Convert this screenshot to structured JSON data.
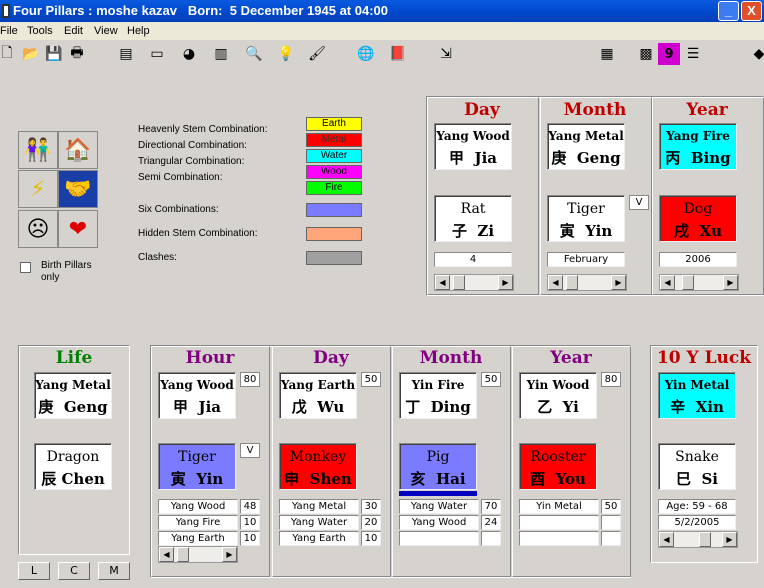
{
  "window": {
    "title": "Four Pillars : moshe kazav   Born:  5 December 1945 at 04:00",
    "min": "_",
    "close": "X"
  },
  "menu": [
    "File",
    "Tools",
    "Edit",
    "View",
    "Help"
  ],
  "colors": {
    "earth": "#ffff00",
    "metal": "#ff0000",
    "water": "#00ffff",
    "wood": "#ff00ff",
    "fire": "#00ff00",
    "six": "#7b7bff",
    "hidden": "#ffa67b",
    "clash": "#a0a0a0"
  },
  "legend": {
    "heavenly": "Heavenly Stem Combination:",
    "directional": "Directional Combination:",
    "triangular": "Triangular Combination:",
    "semi": "Semi Combination:",
    "six": "Six Combinations:",
    "hidden": "Hidden Stem Combination:",
    "clashes": "Clashes:",
    "swatches": [
      "Earth",
      "Metal",
      "Water",
      "Wood",
      "Fire"
    ]
  },
  "birth_pillars": "Birth Pillars only",
  "top": {
    "day": {
      "header": "Day",
      "stem_en": "Yang Wood",
      "stem_cn": "甲",
      "stem_py": "Jia",
      "branch_en": "Rat",
      "branch_cn": "子",
      "branch_py": "Zi",
      "value": "4"
    },
    "month": {
      "header": "Month",
      "stem_en": "Yang Metal",
      "stem_cn": "庚",
      "stem_py": "Geng",
      "branch_en": "Tiger",
      "branch_cn": "寅",
      "branch_py": "Yin",
      "value": "February",
      "tag": "V"
    },
    "year": {
      "header": "Year",
      "stem_en": "Yang Fire",
      "stem_cn": "丙",
      "stem_py": "Bing",
      "branch_en": "Dog",
      "branch_cn": "戌",
      "branch_py": "Xu",
      "value": "2006"
    }
  },
  "life": {
    "header": "Life",
    "stem_en": "Yang Metal",
    "stem_cn": "庚",
    "stem_py": "Geng",
    "branch_en": "Dragon",
    "branch_cn": "辰",
    "branch_py": "Chen"
  },
  "buttons": [
    "L",
    "C",
    "M"
  ],
  "pillars": [
    {
      "header": "Hour",
      "stem_en": "Yang Wood",
      "stem_cn": "甲",
      "stem_py": "Jia",
      "stem_num": "80",
      "branch_en": "Tiger",
      "branch_cn": "寅",
      "branch_py": "Yin",
      "branch_tag": "V",
      "hidden": [
        [
          "Yang Wood",
          "48"
        ],
        [
          "Yang Fire",
          "10"
        ],
        [
          "Yang Earth",
          "10"
        ]
      ]
    },
    {
      "header": "Day",
      "stem_en": "Yang Earth",
      "stem_cn": "戊",
      "stem_py": "Wu",
      "stem_num": "50",
      "branch_en": "Monkey",
      "branch_cn": "申",
      "branch_py": "Shen",
      "branch_tag": "",
      "hidden": [
        [
          "Yang Metal",
          "30"
        ],
        [
          "Yang Water",
          "20"
        ],
        [
          "Yang Earth",
          "10"
        ]
      ]
    },
    {
      "header": "Month",
      "stem_en": "Yin Fire",
      "stem_cn": "丁",
      "stem_py": "Ding",
      "stem_num": "50",
      "branch_en": "Pig",
      "branch_cn": "亥",
      "branch_py": "Hai",
      "branch_tag": "",
      "hidden": [
        [
          "Yang Water",
          "70"
        ],
        [
          "Yang Wood",
          "24"
        ],
        [
          "",
          ""
        ]
      ]
    },
    {
      "header": "Year",
      "stem_en": "Yin Wood",
      "stem_cn": "乙",
      "stem_py": "Yi",
      "stem_num": "80",
      "branch_en": "Rooster",
      "branch_cn": "酉",
      "branch_py": "You",
      "branch_tag": "",
      "hidden": [
        [
          "Yin Metal",
          "50"
        ],
        [
          "",
          ""
        ],
        [
          "",
          ""
        ]
      ]
    }
  ],
  "luck": {
    "header": "10 Y Luck",
    "stem_en": "Yin Metal",
    "stem_cn": "辛",
    "stem_py": "Xin",
    "branch_en": "Snake",
    "branch_cn": "巳",
    "branch_py": "Si",
    "age": "Age: 59 - 68",
    "date": "5/2/2005"
  }
}
